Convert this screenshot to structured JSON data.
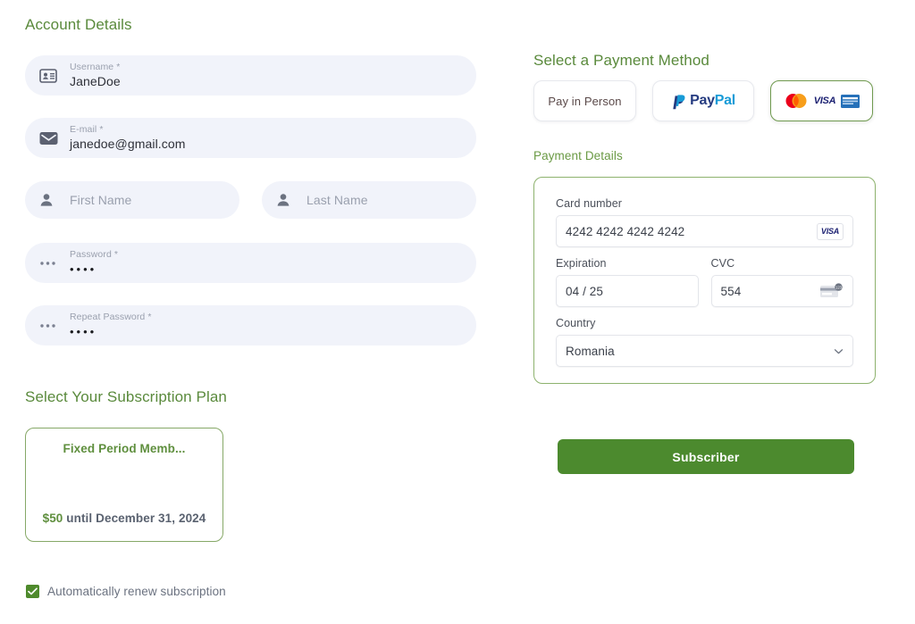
{
  "account": {
    "heading": "Account Details",
    "fields": [
      {
        "name": "username",
        "icon": "id-card-icon",
        "label": "Username *",
        "value": "JaneDoe",
        "placeholder": ""
      },
      {
        "name": "email",
        "icon": "envelope-icon",
        "label": "E-mail *",
        "value": "janedoe@gmail.com",
        "placeholder": ""
      },
      {
        "name": "first-name",
        "icon": "person-icon",
        "label": "",
        "value": "",
        "placeholder": "First Name"
      },
      {
        "name": "last-name",
        "icon": "person-icon",
        "label": "",
        "value": "",
        "placeholder": "Last Name"
      },
      {
        "name": "password",
        "icon": "dots-icon",
        "label": "Password *",
        "value": "••••",
        "placeholder": ""
      },
      {
        "name": "repeat-password",
        "icon": "dots-icon",
        "label": "Repeat Password *",
        "value": "••••",
        "placeholder": ""
      }
    ]
  },
  "subscription": {
    "heading": "Select Your Subscription Plan",
    "plan": {
      "title": "Fixed Period Memb...",
      "price_amount": "$50",
      "price_suffix": " until December 31, 2024"
    },
    "renew": {
      "label": "Automatically renew subscription",
      "checked": true,
      "check_glyph": "✔"
    }
  },
  "payment": {
    "method_heading": "Select a Payment Method",
    "methods": [
      {
        "name": "pay-in-person",
        "label": "Pay in Person",
        "selected": false
      },
      {
        "name": "paypal",
        "label_pay": "Pay",
        "label_pal": "Pal",
        "selected": false
      },
      {
        "name": "credit-card",
        "label": "",
        "selected": true,
        "brands": [
          "mastercard-icon",
          "visa-icon",
          "amex-icon"
        ]
      }
    ],
    "details_heading": "Payment Details",
    "card_number": {
      "label": "Card number",
      "value": "4242 4242 4242 4242",
      "brand": "visa-icon",
      "brand_text": "VISA"
    },
    "expiration": {
      "label": "Expiration",
      "value": "04 / 25"
    },
    "cvc": {
      "label": "CVC",
      "value": "554",
      "icon": "cvc-card-icon"
    },
    "country": {
      "label": "Country",
      "value": "Romania",
      "icon": "chevron-down-icon"
    },
    "submit_label": "Subscriber"
  },
  "colors": {
    "heading_green": "#5a8a3c",
    "accent_green": "#4c8a2e",
    "field_bg": "#f1f3fa",
    "border_green": "#8db26d",
    "visa_blue": "#1a1f71",
    "paypal_dark": "#253b80",
    "paypal_light": "#179bd7",
    "mastercard_red": "#eb001b",
    "mastercard_orange": "#f79e1b",
    "amex_blue": "#2671b9"
  }
}
